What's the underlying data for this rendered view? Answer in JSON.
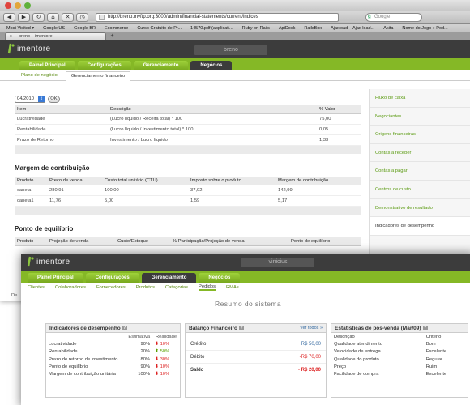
{
  "browser": {
    "url": "http://breno.myftp.org:3000/admin/financial-statements/current/indices",
    "search_placeholder": "Google",
    "bookmarks": [
      "Most Visited ▾",
      "Google US",
      "Google BR",
      "Ecommerce",
      "Curso Gratuito de Pr...",
      "14570.pdf (applicati...",
      "Ruby on Rails",
      "ApiDock",
      "RailsBox",
      "Ajaxload – Ajax load...",
      "Akita",
      "Nome do Jogo » Pod..."
    ],
    "tab_title": "breno – imentore",
    "new_tab": "+"
  },
  "back": {
    "logo": "imentore",
    "user": "breno",
    "nav": [
      "Painel Principal",
      "Configurações",
      "Gerenciamento",
      "Negócios"
    ],
    "subnav": [
      "Plano de negócio",
      "Gerenciamento financeiro"
    ],
    "period": "04/2010",
    "ok": "OK",
    "indices": {
      "headers": [
        "Item",
        "Descrição",
        "% Valor"
      ],
      "rows": [
        [
          "Lucratividade",
          "(Lucro líquido / Receita total) * 100",
          "75,00"
        ],
        [
          "Rentabilidade",
          "(Lucro líquido / Investimento total) * 100",
          "0,05"
        ],
        [
          "Prazo de Retorno",
          "Investimento / Lucro líquido",
          "1,33"
        ]
      ]
    },
    "margem": {
      "title": "Margem de contribuição",
      "headers": [
        "Produto",
        "Preço de venda",
        "Custo total unitário (CTU)",
        "Imposto sobre o produto",
        "Margem de contribuição"
      ],
      "rows": [
        [
          "caneta",
          "280,91",
          "100,00",
          "37,92",
          "142,99"
        ],
        [
          "caneta1",
          "11,76",
          "5,00",
          "1,59",
          "5,17"
        ]
      ]
    },
    "equilibrio": {
      "title": "Ponto de equilíbrio",
      "headers": [
        "Produto",
        "Projeção de venda",
        "Custo/Estoque",
        "% Participação/Projeção de venda",
        "Ponto de equilíbrio"
      ]
    },
    "sidebar": [
      "Fluxo de caixa",
      "Negociantes",
      "Origens financeiras",
      "Contas a receber",
      "Contas a pagar",
      "Centros de custo",
      "Demonstrativo de resultado",
      "Indicadores de desempenho"
    ],
    "cut_label": "De"
  },
  "front": {
    "logo": "imentore",
    "user": "vinicius",
    "nav": [
      "Painel Principal",
      "Configurações",
      "Gerenciamento",
      "Negócios"
    ],
    "subnav": [
      "Clientes",
      "Colaboradores",
      "Fornecedores",
      "Produtos",
      "Categorias",
      "Pedidos",
      "RMAs"
    ],
    "summary_title": "Resumo do sistema",
    "kpi": {
      "title": "Indicadores de desempenho",
      "col_estimativa": "Estimativa",
      "col_realidade": "Realidade",
      "rows": [
        {
          "name": "Lucratividade",
          "est": "90%",
          "real": "10%",
          "dir": "down"
        },
        {
          "name": "Rentabilidade",
          "est": "20%",
          "real": "50%",
          "dir": "up"
        },
        {
          "name": "Prazo de retorno de investimento",
          "est": "80%",
          "real": "30%",
          "dir": "down"
        },
        {
          "name": "Ponto de equilíbrio",
          "est": "90%",
          "real": "10%",
          "dir": "down"
        },
        {
          "name": "Margem de contribuição unitária",
          "est": "100%",
          "real": "10%",
          "dir": "down"
        }
      ]
    },
    "balanco": {
      "title": "Balanço Financeiro",
      "link": "Ver todos »",
      "rows": [
        {
          "label": "Crédito",
          "value": "R$ 50,00",
          "color": "#356aa0"
        },
        {
          "label": "Débito",
          "value": "-R$ 70,00",
          "color": "#d22"
        },
        {
          "label": "Saldo",
          "value": "- R$ 20,00",
          "color": "#d22"
        }
      ]
    },
    "posvenda": {
      "title": "Estatísticas de pós-venda (Mar/09)",
      "headers": [
        "Descrição",
        "Critério"
      ],
      "rows": [
        [
          "Qualidade atendimento",
          "Bom"
        ],
        [
          "Velocidade de entrega",
          "Excelente"
        ],
        [
          "Qualidade do produto",
          "Regular"
        ],
        [
          "Preço",
          "Ruim"
        ],
        [
          "Facilidade de compra",
          "Excelente"
        ]
      ]
    }
  },
  "colors": {
    "accent": "#85b826",
    "header": "#3c3c3c",
    "link": "#5a8a10"
  }
}
